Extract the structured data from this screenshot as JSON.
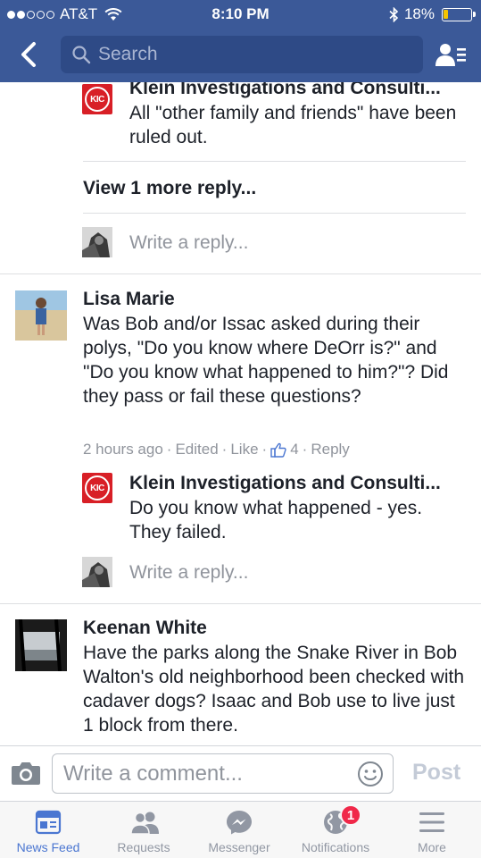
{
  "status_bar": {
    "carrier": "AT&T",
    "time": "8:10 PM",
    "battery": "18%",
    "battery_level": 0.18,
    "battery_color": "#f5c400"
  },
  "header": {
    "back_icon": "chevron-left-icon",
    "search_placeholder": "Search",
    "friends_icon": "friend-list-icon",
    "bar_color": "#3b5998"
  },
  "thread": {
    "reply_1": {
      "author": "Klein Investigations and Consulti...",
      "avatar_text": "KIC",
      "text": "All \"other family and friends\" have been ruled out."
    },
    "view_more": "View 1 more reply...",
    "write_reply_1": "Write a reply...",
    "comment_lisa": {
      "author": "Lisa Marie",
      "text": "Was Bob and/or Issac asked during their polys, \"Do you know where DeOrr is?\" and \"Do you know what happened to him?\"? Did they pass or fail these questions?",
      "time": "2 hours ago",
      "edited": "Edited",
      "like": "Like",
      "like_count": "4",
      "reply": "Reply",
      "separator": "·"
    },
    "reply_2": {
      "author": "Klein Investigations and Consulti...",
      "avatar_text": "KIC",
      "text": "Do you know what happened - yes. They failed."
    },
    "write_reply_2": "Write a reply...",
    "comment_keenan": {
      "author": "Keenan White",
      "text": "Have the parks along the Snake River in Bob Walton's old neighborhood been checked with cadaver dogs?  Isaac and Bob use to live just 1 block from there."
    }
  },
  "composer": {
    "camera_icon": "camera-icon",
    "placeholder": "Write a comment...",
    "emoji_icon": "smiley-icon",
    "post_label": "Post"
  },
  "tabbar": {
    "tabs": [
      {
        "label": "News Feed",
        "icon": "news-feed-icon",
        "active": true
      },
      {
        "label": "Requests",
        "icon": "friend-requests-icon"
      },
      {
        "label": "Messenger",
        "icon": "messenger-icon"
      },
      {
        "label": "Notifications",
        "icon": "globe-icon",
        "badge": "1"
      },
      {
        "label": "More",
        "icon": "hamburger-menu-icon"
      }
    ],
    "active_color": "#4a76d1"
  }
}
